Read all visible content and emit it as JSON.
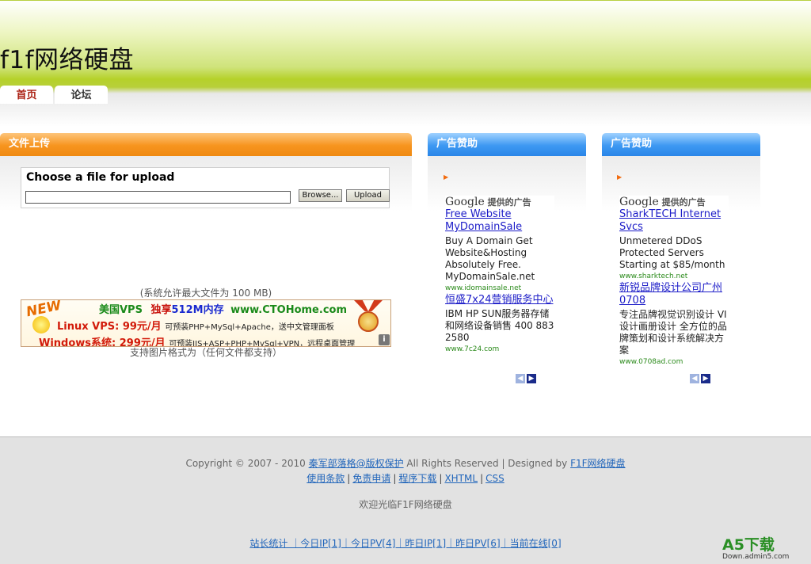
{
  "header": {
    "site_title": "f1f网络硬盘",
    "tabs": [
      {
        "label": "首页",
        "active": true
      },
      {
        "label": "论坛",
        "active": false
      }
    ]
  },
  "upload_panel": {
    "heading": "文件上传",
    "form_title": "Choose a file for upload",
    "file_value": "",
    "browse_label": "Browse...",
    "upload_label": "Upload",
    "max_size_note": "(系统允许最大文件为  100 MB)",
    "types_note": "支持图片格式为（任何文件都支持）"
  },
  "banner_ad": {
    "badge": "NEW",
    "line1_a": "美国VPS",
    "line1_b": "独享",
    "line1_c": "512M内存",
    "line1_d": "www.CTOHome.com",
    "line2_main": "Linux VPS: 99元/月",
    "line2_small": "可预装PHP+MySql+Apache，送中文管理面板",
    "line3_main": "Windows系统: 299元/月",
    "line3_small": "可预装IIS+ASP+PHP+MySql+VPN，远程桌面管理",
    "info_icon": "i"
  },
  "ads": [
    {
      "heading": "广告赞助",
      "google_word": "Google",
      "google_suffix": "提供的广告",
      "items": [
        {
          "title": "Free Website MyDomainSale",
          "text": "Buy A Domain Get Website&Hosting Absolutely Free. MyDomainSale.net",
          "url": "www.idomainsale.net"
        },
        {
          "title": "恒盛7x24营销服务中心",
          "text": "IBM HP SUN服务器存储和网络设备销售 400 883 2580",
          "url": "www.7c24.com"
        }
      ]
    },
    {
      "heading": "广告赞助",
      "google_word": "Google",
      "google_suffix": "提供的广告",
      "items": [
        {
          "title": "SharkTECH Internet Svcs",
          "text": "Unmetered DDoS Protected Servers Starting at $85/month",
          "url": "www.sharktech.net"
        },
        {
          "title": "新锐品牌设计公司广州0708",
          "text": "专注品牌视觉识别设计 VI设计画册设计 全方位的品牌策划和设计系统解决方案",
          "url": "www.0708ad.com"
        }
      ]
    }
  ],
  "footer": {
    "copyright_prefix": "Copyright © 2007 - 2010",
    "owner_link": "秦军部落格@版权保护",
    "rights": "All Rights Reserved | Designed by",
    "designer_link": "F1F网络硬盘",
    "links": [
      "使用条款",
      "免责申请",
      "程序下载",
      "XHTML",
      "CSS"
    ],
    "welcome": "欢迎光临F1F网络硬盘",
    "stats": "站长统计 ｜今日IP[1]｜今日PV[4]｜昨日IP[1]｜昨日PV[6]｜当前在线[0]"
  },
  "watermark": {
    "big": "A5下载",
    "small": "Down.admin5.com"
  },
  "colors": {
    "header_green": "#b5d12a",
    "upload_orange": "#f7941e",
    "ad_blue": "#3d98f2",
    "active_tab": "#aa1f12",
    "link_blue": "#2266bb"
  }
}
